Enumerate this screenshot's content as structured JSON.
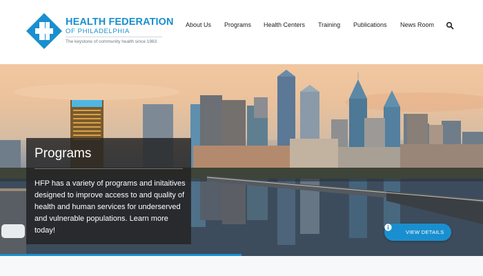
{
  "brand": {
    "name": "HEALTH FEDERATION",
    "sub": "OF PHILADELPHIA",
    "tagline": "The keystone of community health since 1983",
    "color": "#1a8fcf"
  },
  "nav": {
    "items": [
      {
        "label": "About Us"
      },
      {
        "label": "Programs"
      },
      {
        "label": "Health Centers"
      },
      {
        "label": "Training"
      },
      {
        "label": "Publications"
      },
      {
        "label": "News Room"
      }
    ],
    "search_icon": "search-icon"
  },
  "hero": {
    "title": "Programs",
    "text": "HFP has a variety of programs and initaitives designed to improve access to and quality of health and human services for underserved and vulnerable populations. Learn more today!",
    "button_label": "VIEW DETAILS",
    "button_icon": "info-icon",
    "slide_progress": 0.5
  }
}
